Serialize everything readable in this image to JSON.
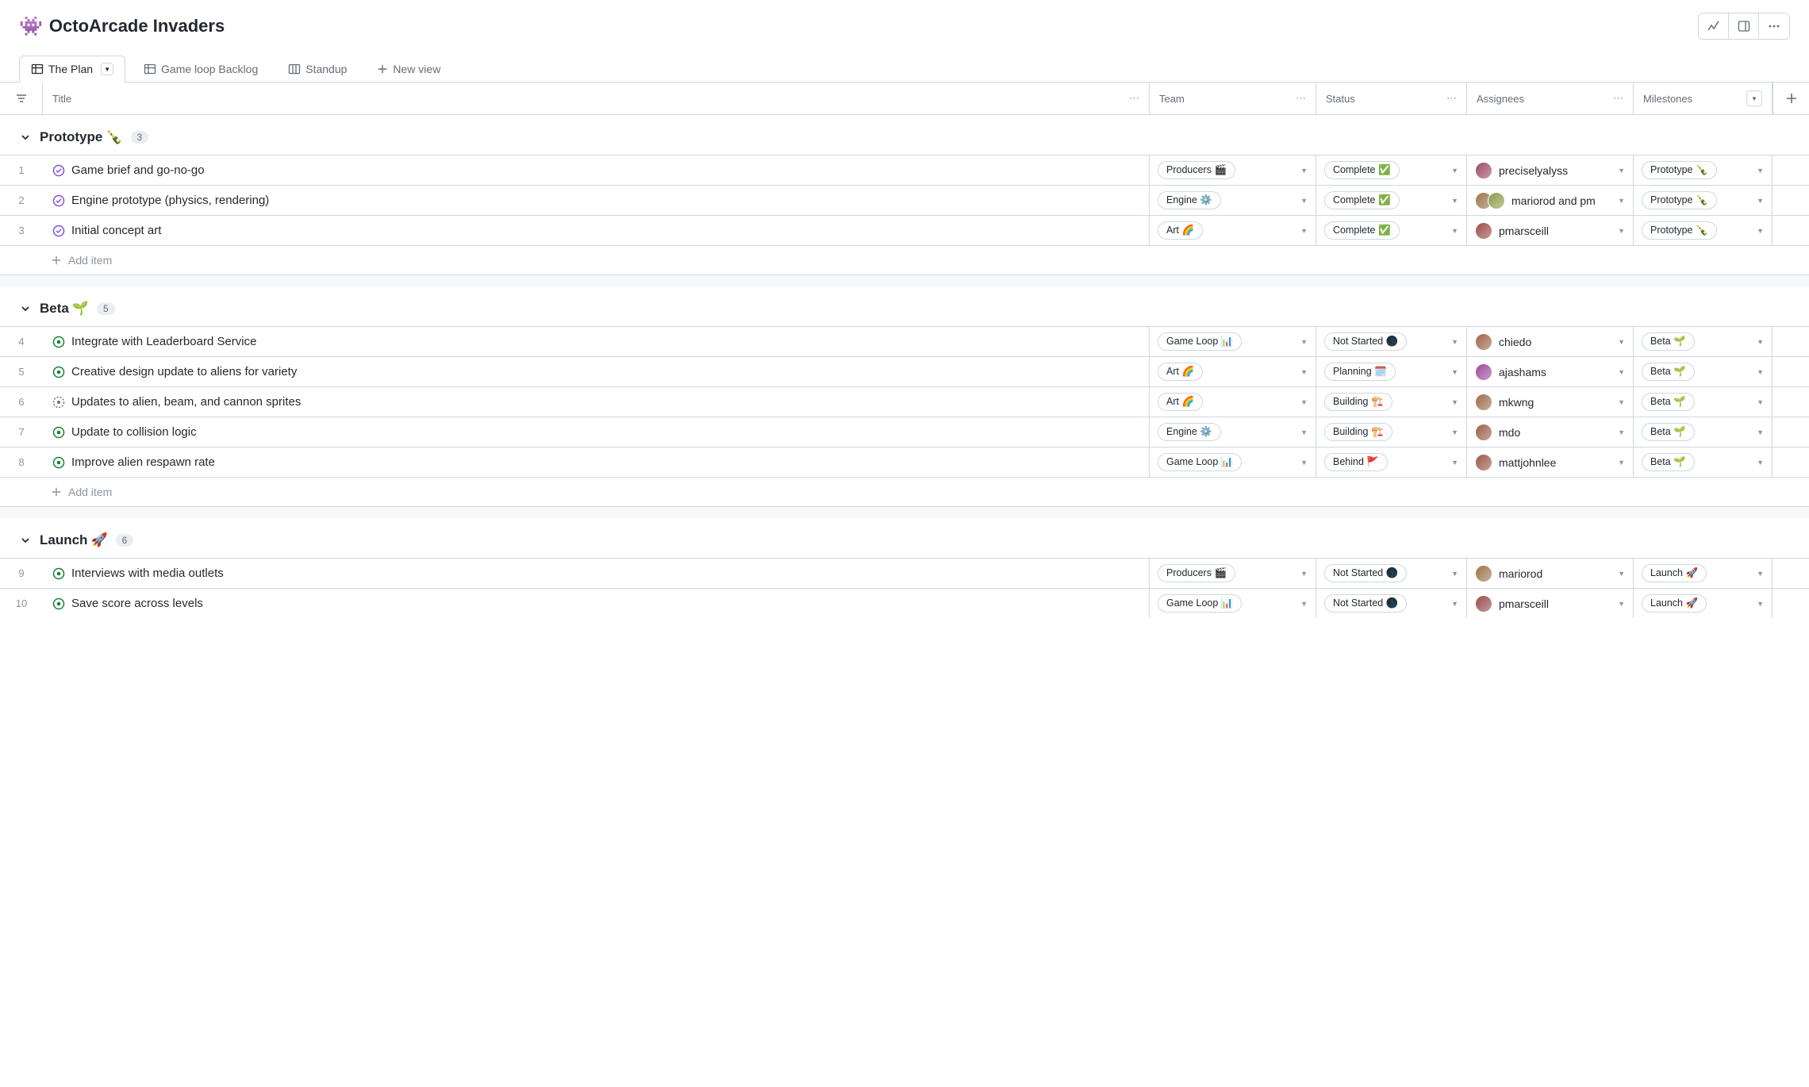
{
  "header": {
    "icon": "👾",
    "title": "OctoArcade Invaders"
  },
  "tabs": [
    {
      "label": "The Plan",
      "active": true,
      "icon": "table",
      "dropdown": true
    },
    {
      "label": "Game loop Backlog",
      "active": false,
      "icon": "table"
    },
    {
      "label": "Standup",
      "active": false,
      "icon": "board"
    },
    {
      "label": "New view",
      "active": false,
      "icon": "plus"
    }
  ],
  "columns": {
    "title": "Title",
    "team": "Team",
    "status": "Status",
    "assignees": "Assignees",
    "milestones": "Milestones"
  },
  "addItem": "Add item",
  "groups": [
    {
      "name": "Prototype",
      "emoji": "🍾",
      "count": 3,
      "rows": [
        {
          "num": 1,
          "iconType": "closed",
          "title": "Game brief and go-no-go",
          "team": "Producers 🎬",
          "status": "Complete ✅",
          "assignees": "preciselyalyss",
          "avatarCount": 1,
          "avatarHue": 340,
          "milestone": "Prototype 🍾"
        },
        {
          "num": 2,
          "iconType": "closed",
          "title": "Engine prototype (physics, rendering)",
          "team": "Engine ⚙️",
          "status": "Complete ✅",
          "assignees": "mariorod and pm",
          "avatarCount": 2,
          "avatarHue": 30,
          "milestone": "Prototype 🍾"
        },
        {
          "num": 3,
          "iconType": "closed",
          "title": "Initial concept art",
          "team": "Art 🌈",
          "status": "Complete ✅",
          "assignees": "pmarsceill",
          "avatarCount": 1,
          "avatarHue": 0,
          "milestone": "Prototype 🍾"
        }
      ]
    },
    {
      "name": "Beta",
      "emoji": "🌱",
      "count": 5,
      "rows": [
        {
          "num": 4,
          "iconType": "open",
          "title": "Integrate with Leaderboard Service",
          "team": "Game Loop 📊",
          "status": "Not Started 🌑",
          "assignees": "chiedo",
          "avatarCount": 1,
          "avatarHue": 20,
          "milestone": "Beta 🌱"
        },
        {
          "num": 5,
          "iconType": "open",
          "title": "Creative design update to aliens for variety",
          "team": "Art 🌈",
          "status": "Planning 🗓️",
          "assignees": "ajashams",
          "avatarCount": 1,
          "avatarHue": 300,
          "milestone": "Beta 🌱"
        },
        {
          "num": 6,
          "iconType": "draft",
          "title": "Updates to alien, beam, and cannon sprites",
          "team": "Art 🌈",
          "status": "Building 🏗️",
          "assignees": "mkwng",
          "avatarCount": 1,
          "avatarHue": 25,
          "milestone": "Beta 🌱"
        },
        {
          "num": 7,
          "iconType": "open",
          "title": "Update to collision logic",
          "team": "Engine ⚙️",
          "status": "Building 🏗️",
          "assignees": "mdo",
          "avatarCount": 1,
          "avatarHue": 15,
          "milestone": "Beta 🌱"
        },
        {
          "num": 8,
          "iconType": "open",
          "title": "Improve alien respawn rate",
          "team": "Game Loop 📊",
          "status": "Behind 🚩",
          "assignees": "mattjohnlee",
          "avatarCount": 1,
          "avatarHue": 10,
          "milestone": "Beta 🌱"
        }
      ]
    },
    {
      "name": "Launch",
      "emoji": "🚀",
      "count": 6,
      "rows": [
        {
          "num": 9,
          "iconType": "open",
          "title": "Interviews with media outlets",
          "team": "Producers 🎬",
          "status": "Not Started 🌑",
          "assignees": "mariorod",
          "avatarCount": 1,
          "avatarHue": 30,
          "milestone": "Launch 🚀"
        },
        {
          "num": 10,
          "iconType": "open",
          "title": "Save score across levels",
          "team": "Game Loop 📊",
          "status": "Not Started 🌑",
          "assignees": "pmarsceill",
          "avatarCount": 1,
          "avatarHue": 0,
          "milestone": "Launch 🚀"
        }
      ]
    }
  ]
}
